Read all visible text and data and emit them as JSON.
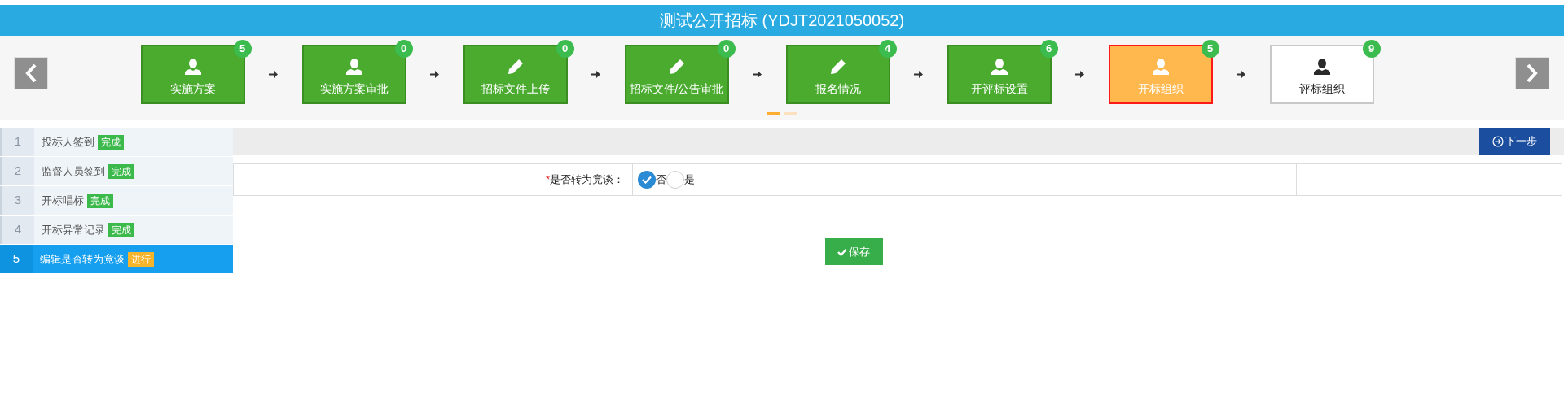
{
  "title": "测试公开招标 (YDJT2021050052)",
  "steps": [
    {
      "label": "实施方案",
      "count": "5",
      "kind": "person",
      "done": true,
      "selected": false
    },
    {
      "label": "实施方案审批",
      "count": "0",
      "kind": "person",
      "done": true,
      "selected": false
    },
    {
      "label": "招标文件上传",
      "count": "0",
      "kind": "pencil",
      "done": true,
      "selected": false
    },
    {
      "label": "招标文件/公告审批",
      "count": "0",
      "kind": "pencil",
      "done": true,
      "selected": false
    },
    {
      "label": "报名情况",
      "count": "4",
      "kind": "pencil",
      "done": true,
      "selected": false
    },
    {
      "label": "开评标设置",
      "count": "6",
      "kind": "person",
      "done": true,
      "selected": false
    },
    {
      "label": "开标组织",
      "count": "5",
      "kind": "person",
      "done": false,
      "selected": true
    },
    {
      "label": "评标组织",
      "count": "9",
      "kind": "person",
      "done": false,
      "selected": false
    }
  ],
  "pager": [
    {
      "selected": true
    },
    {
      "selected": false
    }
  ],
  "sidebar": [
    {
      "number": "1",
      "label": "投标人签到",
      "badge": "完成",
      "done": true,
      "selected": false
    },
    {
      "number": "2",
      "label": "监督人员签到",
      "badge": "完成",
      "done": true,
      "selected": false
    },
    {
      "number": "3",
      "label": "开标唱标",
      "badge": "完成",
      "done": true,
      "selected": false
    },
    {
      "number": "4",
      "label": "开标异常记录",
      "badge": "完成",
      "done": true,
      "selected": false
    },
    {
      "number": "5",
      "label": "编辑是否转为竟谈",
      "badge": "进行",
      "done": false,
      "selected": true
    }
  ],
  "next_button": "下一步",
  "form": {
    "required_mark": "*",
    "label": "是否转为竟谈：",
    "options": [
      {
        "label": "否",
        "selected": true
      },
      {
        "label": "是",
        "selected": false
      }
    ]
  },
  "save_button": "保存"
}
